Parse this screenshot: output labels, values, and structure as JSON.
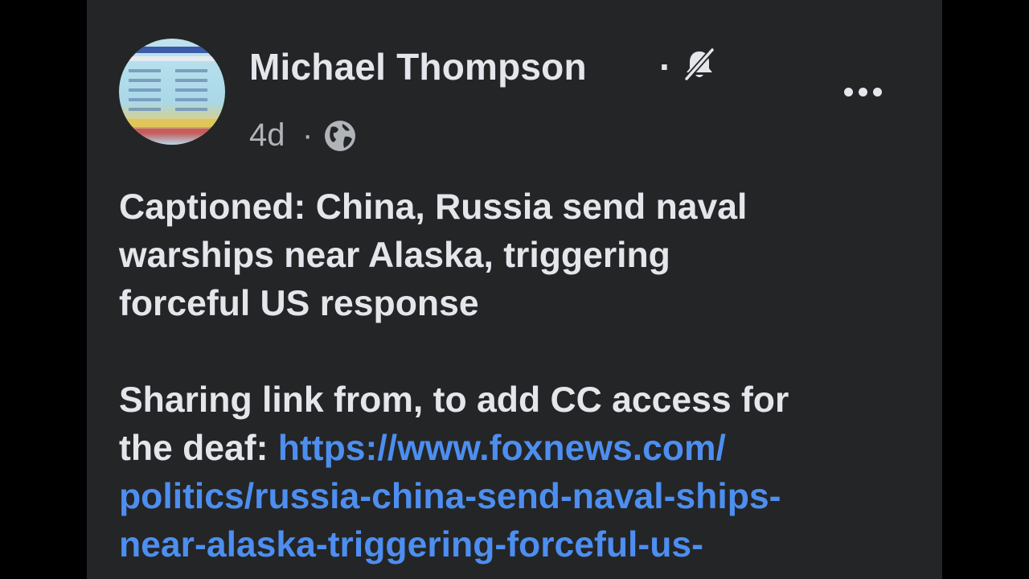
{
  "post": {
    "author": "Michael Thompson",
    "dot": "·",
    "time": "4d",
    "time_sep": "·",
    "headline_line1": "Captioned: China, Russia send naval",
    "headline_line2": "warships near Alaska, triggering",
    "headline_line3": "forceful US response",
    "share_line1": "Sharing link from, to add CC access for",
    "share_line2_prefix": "the deaf: ",
    "link_line1": "https://www.foxnews.com/",
    "link_line2": "politics/russia-china-send-naval-ships-",
    "link_line3": "near-alaska-triggering-forceful-us-",
    "icons": {
      "notifications": "bell-off-icon",
      "privacy": "globe-icon",
      "more": "more-options-icon"
    }
  },
  "colors": {
    "card_bg": "#242526",
    "text_primary": "#e4e6eb",
    "text_secondary": "#b0b3b8",
    "link": "#4d8ef0"
  }
}
